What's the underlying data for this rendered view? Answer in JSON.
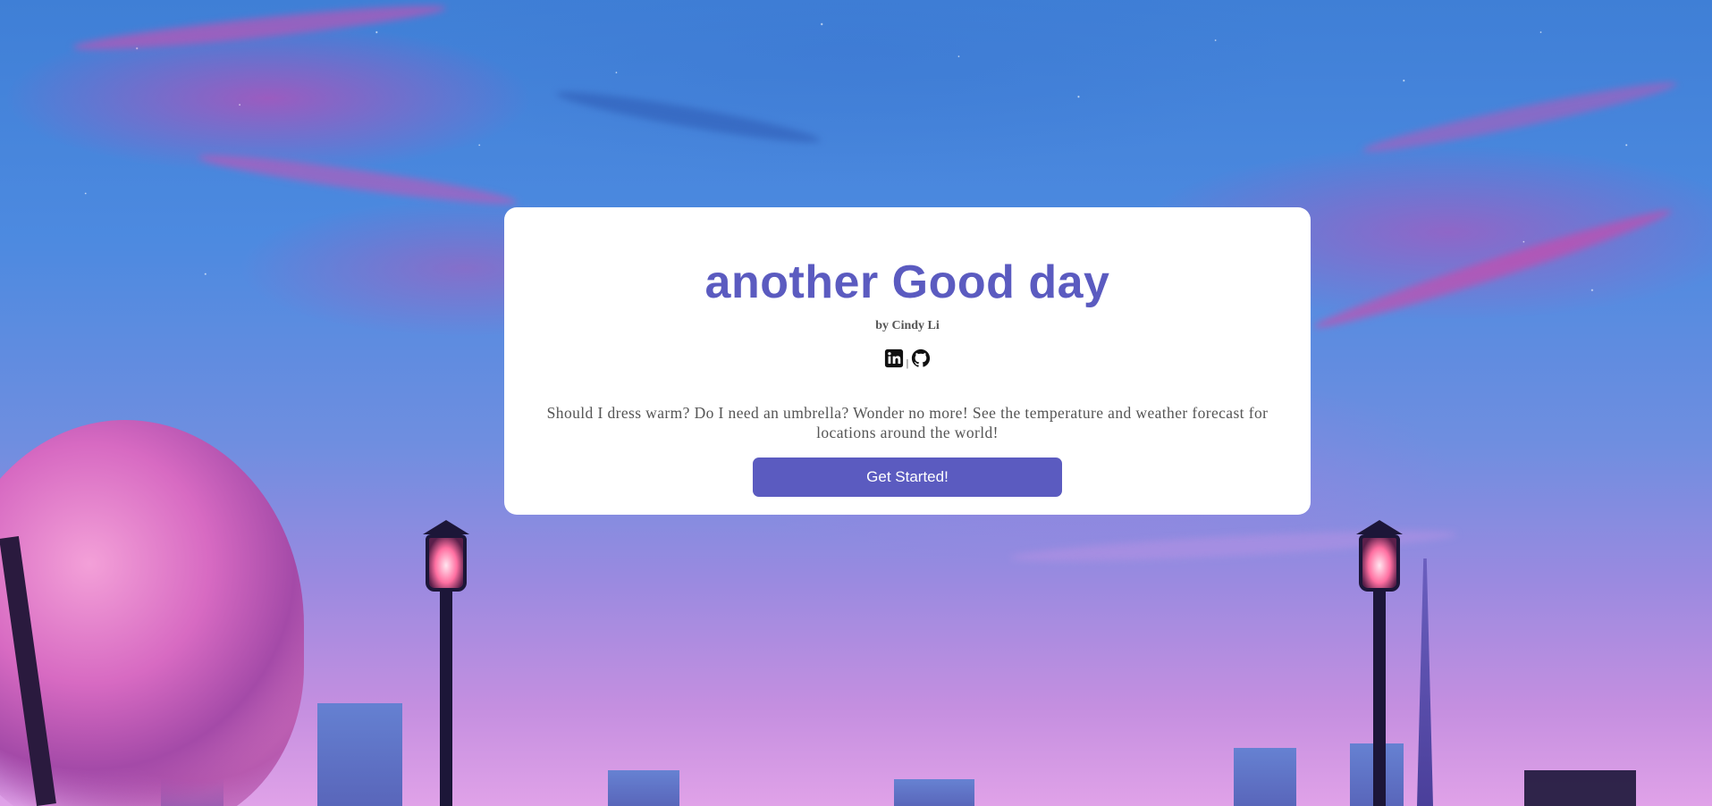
{
  "hero": {
    "title": "another Good day",
    "byline": "by Cindy Li",
    "separator": "|",
    "description": "Should I dress warm? Do I need an umbrella? Wonder no more! See the temperature and weather forecast for locations around the world!",
    "cta_label": "Get Started!"
  },
  "socials": [
    {
      "icon": "linkedin-icon"
    },
    {
      "icon": "github-icon"
    }
  ],
  "colors": {
    "accent": "#5b5bc0",
    "card_bg": "#ffffff",
    "text_muted": "#555555"
  }
}
